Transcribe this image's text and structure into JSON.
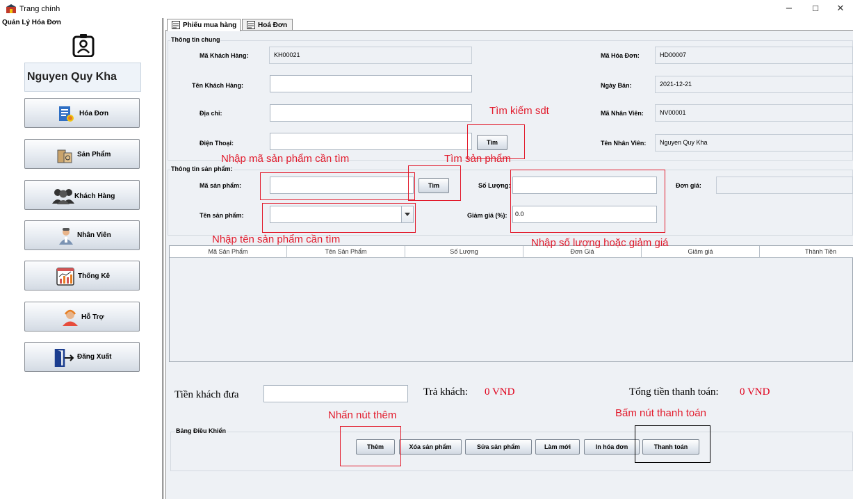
{
  "window": {
    "title": "Trang chính",
    "minimize": "−",
    "maximize": "☐",
    "close": "✕"
  },
  "sidebar": {
    "title": "Quản Lý Hóa Đơn",
    "user_name": "Nguyen Quy Kha",
    "items": [
      {
        "label": "Hóa Đơn",
        "icon": "invoice-icon"
      },
      {
        "label": "Sản Phẩm",
        "icon": "product-box-icon"
      },
      {
        "label": "Khách Hàng",
        "icon": "customers-icon"
      },
      {
        "label": "Nhân Viên",
        "icon": "employee-icon"
      },
      {
        "label": "Thống Kê",
        "icon": "statistics-chart-icon"
      },
      {
        "label": "Hỗ Trợ",
        "icon": "support-headset-icon"
      },
      {
        "label": "Đăng Xuất",
        "icon": "logout-door-icon"
      }
    ]
  },
  "tabs": [
    {
      "label": "Phiếu mua hàng",
      "active": true
    },
    {
      "label": "Hoá Đơn",
      "active": false
    }
  ],
  "general": {
    "title": "Thông tin chung",
    "customer_id_label": "Mã Khách Hàng:",
    "customer_id": "KH00021",
    "customer_name_label": "Tên Khách Hàng:",
    "customer_name": "",
    "address_label": "Địa chỉ:",
    "address": "",
    "phone_label": "Điện Thoại:",
    "phone": "",
    "search_button": "Tìm",
    "invoice_id_label": "Mã Hóa Đơn:",
    "invoice_id": "HD00007",
    "sale_date_label": "Ngày Bán:",
    "sale_date": "2021-12-21",
    "employee_id_label": "Mã Nhân Viên:",
    "employee_id": "NV00001",
    "employee_name_label": "Tên Nhân Viên:",
    "employee_name": "Nguyen Quy Kha"
  },
  "product": {
    "title": "Thông tin sản phẩm:",
    "code_label": "Mã sản phẩm:",
    "code": "",
    "search_button": "Tìm",
    "name_label": "Tên sản phẩm:",
    "name": "",
    "quantity_label": "Số Lượng:",
    "quantity": "",
    "discount_label": "Giảm giá (%):",
    "discount": "0.0",
    "price_label": "Đơn giá:",
    "price": ""
  },
  "table": {
    "columns": [
      "Mã Sản Phẩm",
      "Tên Sản Phẩm",
      "Số Lượng",
      "Đơn Giá",
      "Giảm giá",
      "Thành Tiền"
    ]
  },
  "payment": {
    "cash_label": "Tiền khách đưa",
    "cash": "",
    "change_label": "Trả khách:",
    "change_value": "0 VND",
    "total_label": "Tổng tiền thanh toán:",
    "total_value": "0 VND"
  },
  "controls": {
    "title": "Bảng Điều Khiển",
    "add": "Thêm",
    "remove": "Xóa sản phẩm",
    "edit": "Sửa sản phẩm",
    "refresh": "Làm mới",
    "print": "In hóa đơn",
    "pay": "Thanh toán"
  },
  "annotations": {
    "search_phone": "Tìm kiếm sdt",
    "enter_code": "Nhập mã sản phẩm cần tìm",
    "find_product": "Tìm sản phẩm",
    "enter_name": "Nhập tên sản phẩm cần tìm",
    "enter_qty": "Nhập số lượng hoặc giảm giá",
    "press_add": "Nhấn nút thêm",
    "press_pay": "Bấm nút thanh toán"
  },
  "colors": {
    "annotation": "#e21b2c",
    "money": "#e0001b",
    "panel_bg": "#eef1f5"
  }
}
